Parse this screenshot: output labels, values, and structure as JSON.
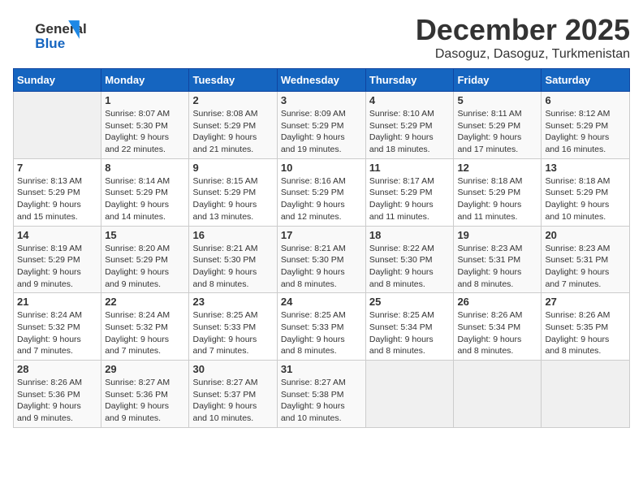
{
  "header": {
    "logo_general": "General",
    "logo_blue": "Blue",
    "month": "December 2025",
    "location": "Dasoguz, Dasoguz, Turkmenistan"
  },
  "weekdays": [
    "Sunday",
    "Monday",
    "Tuesday",
    "Wednesday",
    "Thursday",
    "Friday",
    "Saturday"
  ],
  "weeks": [
    [
      {
        "day": "",
        "info": ""
      },
      {
        "day": "1",
        "info": "Sunrise: 8:07 AM\nSunset: 5:30 PM\nDaylight: 9 hours\nand 22 minutes."
      },
      {
        "day": "2",
        "info": "Sunrise: 8:08 AM\nSunset: 5:29 PM\nDaylight: 9 hours\nand 21 minutes."
      },
      {
        "day": "3",
        "info": "Sunrise: 8:09 AM\nSunset: 5:29 PM\nDaylight: 9 hours\nand 19 minutes."
      },
      {
        "day": "4",
        "info": "Sunrise: 8:10 AM\nSunset: 5:29 PM\nDaylight: 9 hours\nand 18 minutes."
      },
      {
        "day": "5",
        "info": "Sunrise: 8:11 AM\nSunset: 5:29 PM\nDaylight: 9 hours\nand 17 minutes."
      },
      {
        "day": "6",
        "info": "Sunrise: 8:12 AM\nSunset: 5:29 PM\nDaylight: 9 hours\nand 16 minutes."
      }
    ],
    [
      {
        "day": "7",
        "info": "Sunrise: 8:13 AM\nSunset: 5:29 PM\nDaylight: 9 hours\nand 15 minutes."
      },
      {
        "day": "8",
        "info": "Sunrise: 8:14 AM\nSunset: 5:29 PM\nDaylight: 9 hours\nand 14 minutes."
      },
      {
        "day": "9",
        "info": "Sunrise: 8:15 AM\nSunset: 5:29 PM\nDaylight: 9 hours\nand 13 minutes."
      },
      {
        "day": "10",
        "info": "Sunrise: 8:16 AM\nSunset: 5:29 PM\nDaylight: 9 hours\nand 12 minutes."
      },
      {
        "day": "11",
        "info": "Sunrise: 8:17 AM\nSunset: 5:29 PM\nDaylight: 9 hours\nand 11 minutes."
      },
      {
        "day": "12",
        "info": "Sunrise: 8:18 AM\nSunset: 5:29 PM\nDaylight: 9 hours\nand 11 minutes."
      },
      {
        "day": "13",
        "info": "Sunrise: 8:18 AM\nSunset: 5:29 PM\nDaylight: 9 hours\nand 10 minutes."
      }
    ],
    [
      {
        "day": "14",
        "info": "Sunrise: 8:19 AM\nSunset: 5:29 PM\nDaylight: 9 hours\nand 9 minutes."
      },
      {
        "day": "15",
        "info": "Sunrise: 8:20 AM\nSunset: 5:29 PM\nDaylight: 9 hours\nand 9 minutes."
      },
      {
        "day": "16",
        "info": "Sunrise: 8:21 AM\nSunset: 5:30 PM\nDaylight: 9 hours\nand 8 minutes."
      },
      {
        "day": "17",
        "info": "Sunrise: 8:21 AM\nSunset: 5:30 PM\nDaylight: 9 hours\nand 8 minutes."
      },
      {
        "day": "18",
        "info": "Sunrise: 8:22 AM\nSunset: 5:30 PM\nDaylight: 9 hours\nand 8 minutes."
      },
      {
        "day": "19",
        "info": "Sunrise: 8:23 AM\nSunset: 5:31 PM\nDaylight: 9 hours\nand 8 minutes."
      },
      {
        "day": "20",
        "info": "Sunrise: 8:23 AM\nSunset: 5:31 PM\nDaylight: 9 hours\nand 7 minutes."
      }
    ],
    [
      {
        "day": "21",
        "info": "Sunrise: 8:24 AM\nSunset: 5:32 PM\nDaylight: 9 hours\nand 7 minutes."
      },
      {
        "day": "22",
        "info": "Sunrise: 8:24 AM\nSunset: 5:32 PM\nDaylight: 9 hours\nand 7 minutes."
      },
      {
        "day": "23",
        "info": "Sunrise: 8:25 AM\nSunset: 5:33 PM\nDaylight: 9 hours\nand 7 minutes."
      },
      {
        "day": "24",
        "info": "Sunrise: 8:25 AM\nSunset: 5:33 PM\nDaylight: 9 hours\nand 8 minutes."
      },
      {
        "day": "25",
        "info": "Sunrise: 8:25 AM\nSunset: 5:34 PM\nDaylight: 9 hours\nand 8 minutes."
      },
      {
        "day": "26",
        "info": "Sunrise: 8:26 AM\nSunset: 5:34 PM\nDaylight: 9 hours\nand 8 minutes."
      },
      {
        "day": "27",
        "info": "Sunrise: 8:26 AM\nSunset: 5:35 PM\nDaylight: 9 hours\nand 8 minutes."
      }
    ],
    [
      {
        "day": "28",
        "info": "Sunrise: 8:26 AM\nSunset: 5:36 PM\nDaylight: 9 hours\nand 9 minutes."
      },
      {
        "day": "29",
        "info": "Sunrise: 8:27 AM\nSunset: 5:36 PM\nDaylight: 9 hours\nand 9 minutes."
      },
      {
        "day": "30",
        "info": "Sunrise: 8:27 AM\nSunset: 5:37 PM\nDaylight: 9 hours\nand 10 minutes."
      },
      {
        "day": "31",
        "info": "Sunrise: 8:27 AM\nSunset: 5:38 PM\nDaylight: 9 hours\nand 10 minutes."
      },
      {
        "day": "",
        "info": ""
      },
      {
        "day": "",
        "info": ""
      },
      {
        "day": "",
        "info": ""
      }
    ]
  ]
}
